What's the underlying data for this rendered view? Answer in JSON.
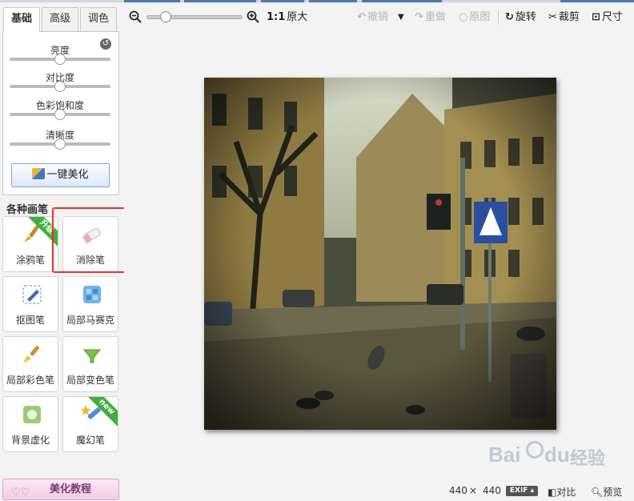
{
  "tabs": [
    {
      "label": "基础",
      "active": true
    },
    {
      "label": "高级",
      "active": false
    },
    {
      "label": "调色",
      "active": false
    }
  ],
  "adjust": {
    "sliders": [
      {
        "label": "亮度",
        "value": 0.5
      },
      {
        "label": "对比度",
        "value": 0.5
      },
      {
        "label": "色彩饱和度",
        "value": 0.5
      },
      {
        "label": "清晰度",
        "value": 0.5
      }
    ],
    "auto_button": "一键美化"
  },
  "brushes": {
    "title": "各种画笔",
    "items": [
      {
        "label": "涂鸦笔",
        "icon": "paintbrush-icon",
        "badge": "升级"
      },
      {
        "label": "消除笔",
        "icon": "eraser-icon",
        "badge": ""
      },
      {
        "label": "抠图笔",
        "icon": "cutout-pen-icon",
        "badge": ""
      },
      {
        "label": "局部马赛克",
        "icon": "mosaic-icon",
        "badge": ""
      },
      {
        "label": "局部彩色笔",
        "icon": "color-brush-icon",
        "badge": ""
      },
      {
        "label": "局部变色笔",
        "icon": "color-change-icon",
        "badge": ""
      },
      {
        "label": "背景虚化",
        "icon": "background-blur-icon",
        "badge": ""
      },
      {
        "label": "魔幻笔",
        "icon": "magic-wand-icon",
        "badge": "new"
      }
    ]
  },
  "tutorial_button": "美化教程",
  "toolbar": {
    "zoom_level": 0.2,
    "actual_size_icon": "1:1",
    "actual_size_label": "原大",
    "undo_label": "撤销",
    "redo_label": "重做",
    "original_label": "原图",
    "rotate_label": "旋转",
    "crop_label": "裁剪",
    "resize_label": "尺寸"
  },
  "status": {
    "width": "440",
    "times": "×",
    "height": "440",
    "exif_label": "EXIF",
    "compare_label": "对比",
    "preview_label": "预览"
  },
  "watermark": {
    "brand": "Bai",
    "brand2": "du",
    "site": "经验"
  },
  "colors": {
    "highlight": "#e8332a",
    "accent": "#4a78b8"
  }
}
